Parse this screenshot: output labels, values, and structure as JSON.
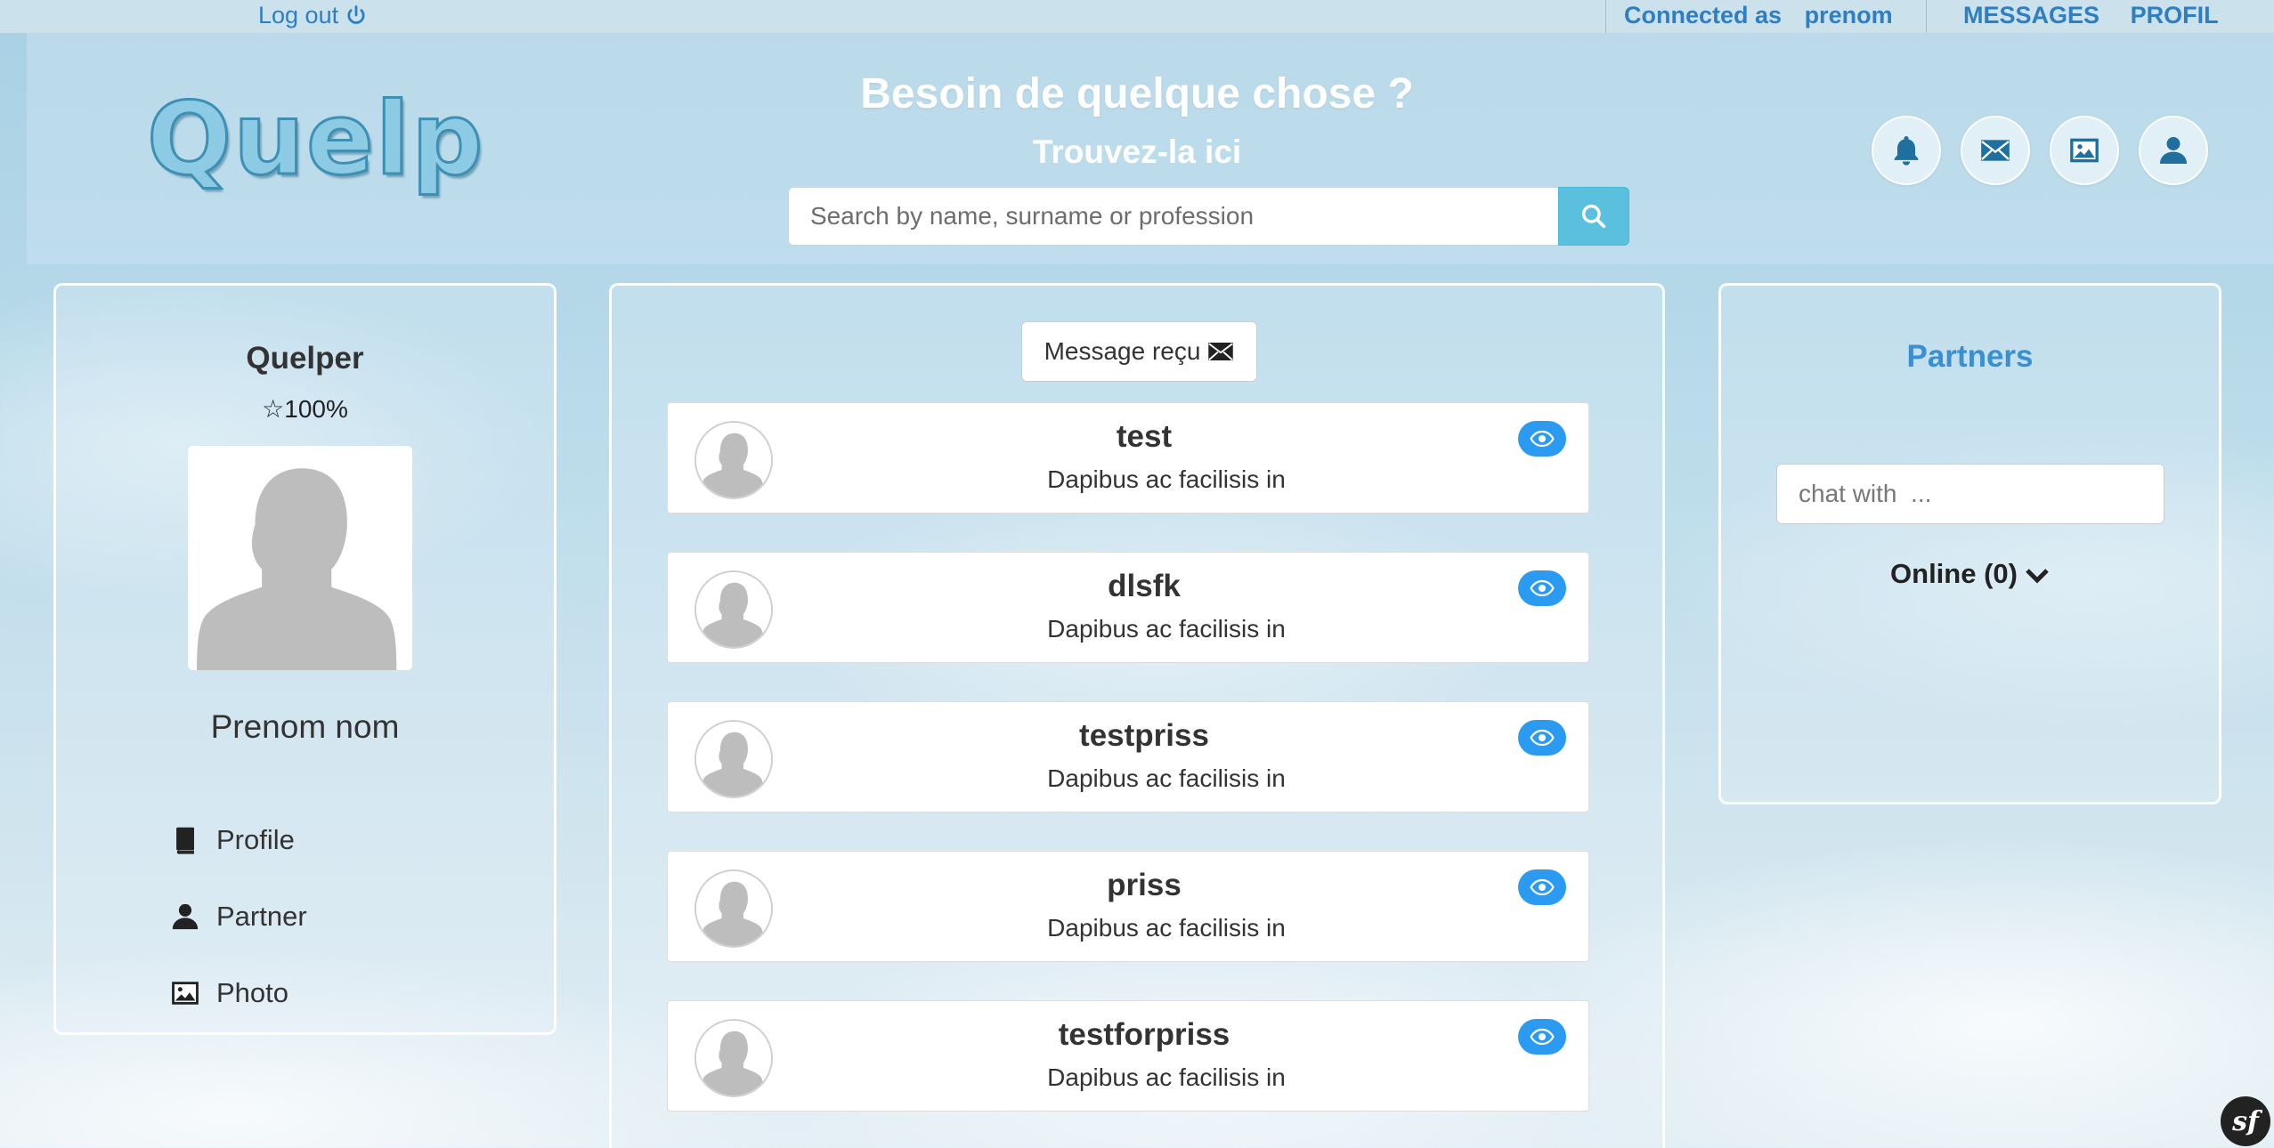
{
  "topbar": {
    "logout_label": "Log out",
    "connected_label": "Connected as",
    "username": "prenom",
    "nav": [
      "MESSAGES",
      "PROFIL"
    ]
  },
  "header": {
    "logo_text": "Quelp",
    "title": "Besoin de quelque chose ?",
    "subtitle": "Trouvez-la ici",
    "search_placeholder": "Search by name, surname or profession",
    "icons": [
      "bell-icon",
      "envelope-icon",
      "picture-icon",
      "user-icon"
    ]
  },
  "left_panel": {
    "name": "Quelper",
    "rating": "☆100%",
    "full_name": "Prenom nom",
    "nav": [
      {
        "label": "Profile",
        "icon": "book-icon"
      },
      {
        "label": "Partner",
        "icon": "user-icon"
      },
      {
        "label": "Photo",
        "icon": "picture-icon"
      }
    ]
  },
  "center_panel": {
    "button_label": "Message reçu",
    "messages": [
      {
        "name": "test",
        "text": "Dapibus ac facilisis in"
      },
      {
        "name": "dlsfk",
        "text": "Dapibus ac facilisis in"
      },
      {
        "name": "testpriss",
        "text": "Dapibus ac facilisis in"
      },
      {
        "name": "priss",
        "text": "Dapibus ac facilisis in"
      },
      {
        "name": "testforpriss",
        "text": "Dapibus ac facilisis in"
      }
    ]
  },
  "right_panel": {
    "title": "Partners",
    "chat_placeholder": "chat with  ...",
    "online_label": "Online (0)"
  },
  "colors": {
    "accent": "#2f7fc0",
    "search_button": "#5bc0de",
    "eye_button": "#2a9bf0",
    "partners_title": "#3a8fd0"
  },
  "footer": {
    "badge_text": "sf"
  }
}
